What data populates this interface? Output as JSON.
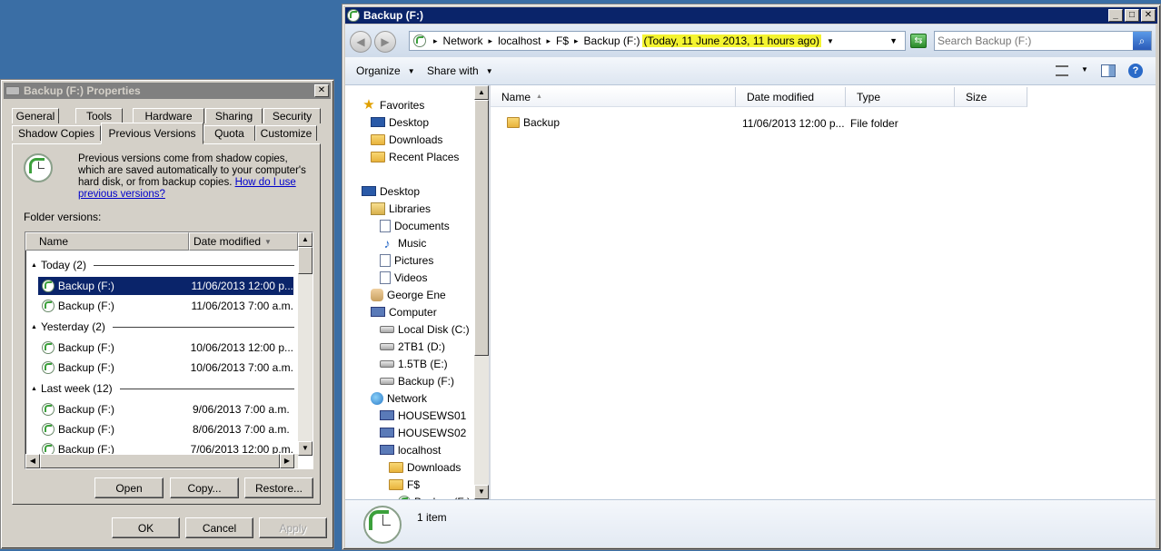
{
  "props": {
    "title": "Backup (F:) Properties",
    "close": "✕",
    "tabs_row1": [
      "General",
      "Tools",
      "Hardware",
      "Sharing",
      "Security"
    ],
    "tabs_row2": [
      "Shadow Copies",
      "Previous Versions",
      "Quota",
      "Customize"
    ],
    "description": "Previous versions come from shadow copies, which are saved automatically to your computer's hard disk, or from backup copies.",
    "help_link": "How do I use previous versions?",
    "folder_versions_label": "Folder versions:",
    "col_name": "Name",
    "col_date": "Date modified",
    "groups": [
      {
        "label": "Today (2)",
        "rows": [
          {
            "name": "Backup (F:)",
            "date": "11/06/2013 12:00 p..."
          },
          {
            "name": "Backup (F:)",
            "date": "11/06/2013 7:00 a.m."
          }
        ]
      },
      {
        "label": "Yesterday (2)",
        "rows": [
          {
            "name": "Backup (F:)",
            "date": "10/06/2013 12:00 p..."
          },
          {
            "name": "Backup (F:)",
            "date": "10/06/2013 7:00 a.m."
          }
        ]
      },
      {
        "label": "Last week (12)",
        "rows": [
          {
            "name": "Backup (F:)",
            "date": "9/06/2013 7:00 a.m."
          },
          {
            "name": "Backup (F:)",
            "date": "8/06/2013 7:00 a.m."
          },
          {
            "name": "Backup (F:)",
            "date": "7/06/2013 12:00 p.m."
          }
        ]
      }
    ],
    "open": "Open",
    "copy": "Copy...",
    "restore": "Restore...",
    "ok": "OK",
    "cancel": "Cancel",
    "apply": "Apply"
  },
  "explorer": {
    "title": "Backup (F:)",
    "crumbs": [
      "Network",
      "localhost",
      "F$",
      "Backup (F:)"
    ],
    "crumb_time": "(Today, 11 June 2013, 11 hours ago)",
    "search_placeholder": "Search Backup (F:)",
    "organize": "Organize",
    "share_with": "Share with",
    "nav": [
      {
        "label": "Favorites",
        "icon": "star-icon",
        "indent": 0
      },
      {
        "label": "Desktop",
        "icon": "monitor-icon",
        "indent": 1
      },
      {
        "label": "Downloads",
        "icon": "folder-icon",
        "indent": 1
      },
      {
        "label": "Recent Places",
        "icon": "folder-icon",
        "indent": 1
      },
      {
        "label": "Desktop",
        "icon": "monitor-icon",
        "indent": 0
      },
      {
        "label": "Libraries",
        "icon": "library-icon",
        "indent": 1
      },
      {
        "label": "Documents",
        "icon": "document-icon",
        "indent": 2
      },
      {
        "label": "Music",
        "icon": "music-icon",
        "indent": 2
      },
      {
        "label": "Pictures",
        "icon": "picture-icon",
        "indent": 2
      },
      {
        "label": "Videos",
        "icon": "video-icon",
        "indent": 2
      },
      {
        "label": "George Ene",
        "icon": "user-icon",
        "indent": 1
      },
      {
        "label": "Computer",
        "icon": "computer-icon",
        "indent": 1
      },
      {
        "label": "Local Disk (C:)",
        "icon": "drive-icon",
        "indent": 2
      },
      {
        "label": "2TB1 (D:)",
        "icon": "drive-icon",
        "indent": 2
      },
      {
        "label": "1.5TB (E:)",
        "icon": "drive-icon",
        "indent": 2
      },
      {
        "label": "Backup (F:)",
        "icon": "drive-icon",
        "indent": 2
      },
      {
        "label": "Network",
        "icon": "globe-icon",
        "indent": 1
      },
      {
        "label": "HOUSEWS01",
        "icon": "computer-icon",
        "indent": 2
      },
      {
        "label": "HOUSEWS02",
        "icon": "computer-icon",
        "indent": 2
      },
      {
        "label": "localhost",
        "icon": "computer-icon",
        "indent": 2
      },
      {
        "label": "Downloads",
        "icon": "folder-icon",
        "indent": 3
      },
      {
        "label": "F$",
        "icon": "folder-icon",
        "indent": 3
      },
      {
        "label": "Backup (F:)",
        "icon": "clock-icon",
        "indent": 4
      }
    ],
    "columns": [
      "Name",
      "Date modified",
      "Type",
      "Size"
    ],
    "files": [
      {
        "name": "Backup",
        "date": "11/06/2013 12:00 p...",
        "type": "File folder",
        "size": ""
      }
    ],
    "status": "1 item"
  }
}
